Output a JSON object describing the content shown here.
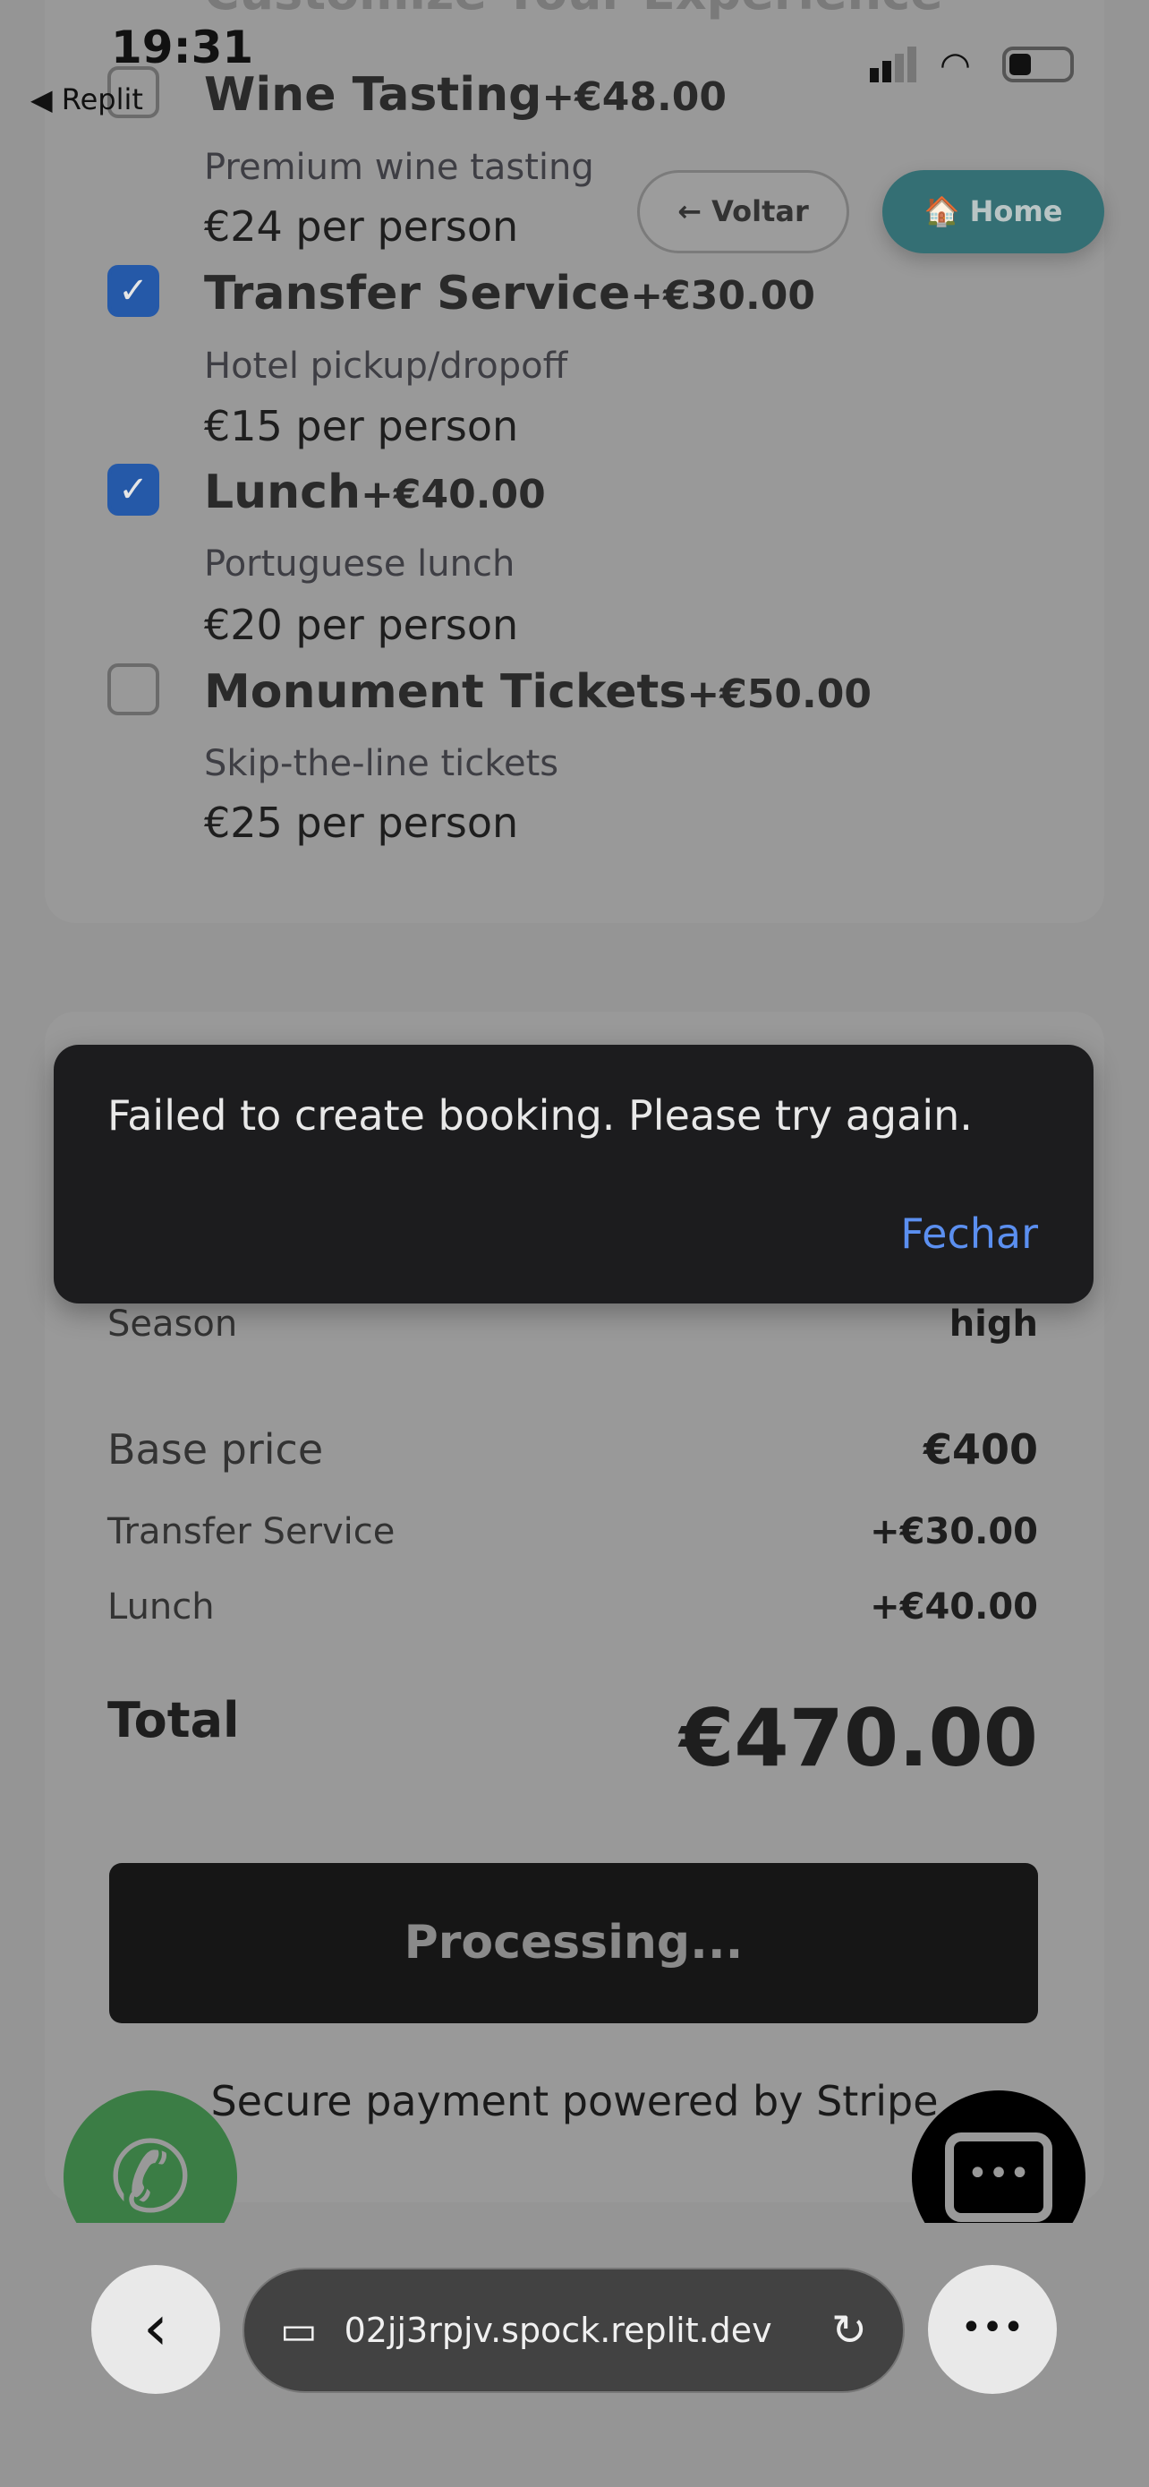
{
  "status_bar": {
    "time": "19:31",
    "back_app": "◀ Replit"
  },
  "section_title": "Customize Your Experience",
  "addons": [
    {
      "name": "Wine Tasting",
      "price": "+€48.00",
      "description": "Premium wine tasting",
      "per_person": "€24 per person",
      "checked": false
    },
    {
      "name": "Transfer Service",
      "price": "+€30.00",
      "description": "Hotel pickup/dropoff",
      "per_person": "€15 per person",
      "checked": true
    },
    {
      "name": "Lunch",
      "price": "+€40.00",
      "description": "Portuguese lunch",
      "per_person": "€20 per person",
      "checked": true
    },
    {
      "name": "Monument Tickets",
      "price": "+€50.00",
      "description": "Skip-the-line tickets",
      "per_person": "€25 per person",
      "checked": false
    }
  ],
  "nav": {
    "back_label": "← Voltar",
    "home_label": "🏠 Home"
  },
  "toast": {
    "message": "Failed to create booking. Please try again.",
    "close_label": "Fechar"
  },
  "summary": {
    "season_label": "Season",
    "season_value": "high",
    "base_label": "Base price",
    "base_value": "€400",
    "lines": [
      {
        "label": "Transfer Service",
        "value": "+€30.00"
      },
      {
        "label": "Lunch",
        "value": "+€40.00"
      }
    ],
    "total_label": "Total",
    "total_value": "€470.00"
  },
  "pay_button": "Processing...",
  "secure_note": "Secure payment powered by Stripe",
  "browser": {
    "url": "02jj3rpjv.spock.replit.dev"
  },
  "colors": {
    "whatsapp": "#3b7d45",
    "checkbox": "#2559a8",
    "home": "#346f74",
    "toast": "#1c1c1e",
    "link": "#5b8ff0"
  }
}
